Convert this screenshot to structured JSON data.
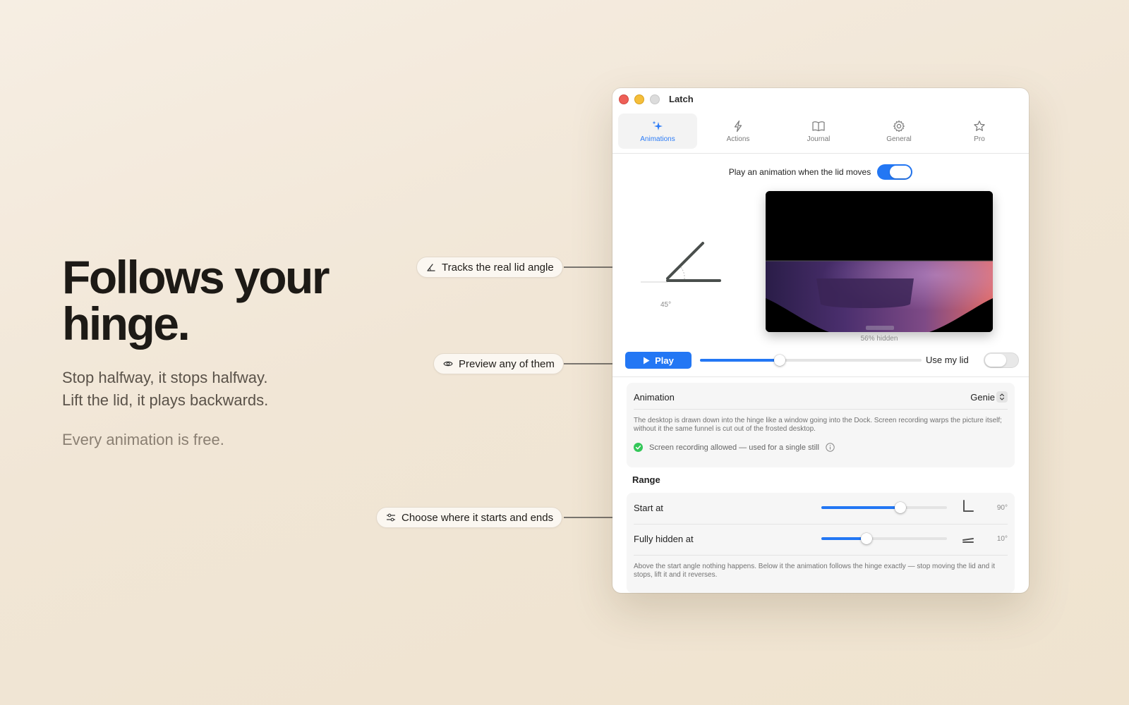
{
  "marketing": {
    "headline": "Follows your hinge.",
    "sub_line1": "Stop halfway, it stops halfway.",
    "sub_line2": "Lift the lid, it plays backwards.",
    "free_line": "Every animation is free."
  },
  "callouts": [
    {
      "label": "Tracks the real lid angle",
      "icon": "angle-icon"
    },
    {
      "label": "Preview any of them",
      "icon": "eye-icon"
    },
    {
      "label": "Choose where it starts and ends",
      "icon": "sliders-icon"
    }
  ],
  "window": {
    "title": "Latch",
    "tabs": [
      {
        "label": "Animations",
        "icon": "sparkles-icon",
        "active": true
      },
      {
        "label": "Actions",
        "icon": "bolt-icon",
        "active": false
      },
      {
        "label": "Journal",
        "icon": "book-icon",
        "active": false
      },
      {
        "label": "General",
        "icon": "gear-icon",
        "active": false
      },
      {
        "label": "Pro",
        "icon": "star-icon",
        "active": false
      }
    ],
    "play_animation_label": "Play an animation when the lid moves",
    "play_animation_enabled": true,
    "lid_angle_label": "45°",
    "hidden_label": "56% hidden",
    "play_button": "Play",
    "scrub_progress": 0.36,
    "use_my_lid_label": "Use my lid",
    "use_my_lid_enabled": false,
    "animation": {
      "label": "Animation",
      "value": "Genie",
      "description": "The desktop is drawn down into the hinge like a window going into the Dock. Screen recording warps the picture itself; without it the same funnel is cut out of the frosted desktop.",
      "permission_text": "Screen recording allowed — used for a single still"
    },
    "range": {
      "title": "Range",
      "start": {
        "label": "Start at",
        "value": 0.63,
        "degrees": "90°"
      },
      "hidden": {
        "label": "Fully hidden at",
        "value": 0.36,
        "degrees": "10°"
      },
      "note": "Above the start angle nothing happens. Below it the animation follows the hinge exactly — stop moving the lid and it stops, lift it and it reverses."
    }
  },
  "colors": {
    "accent": "#2377f4",
    "success": "#34c759",
    "background": "#f3e9da"
  }
}
